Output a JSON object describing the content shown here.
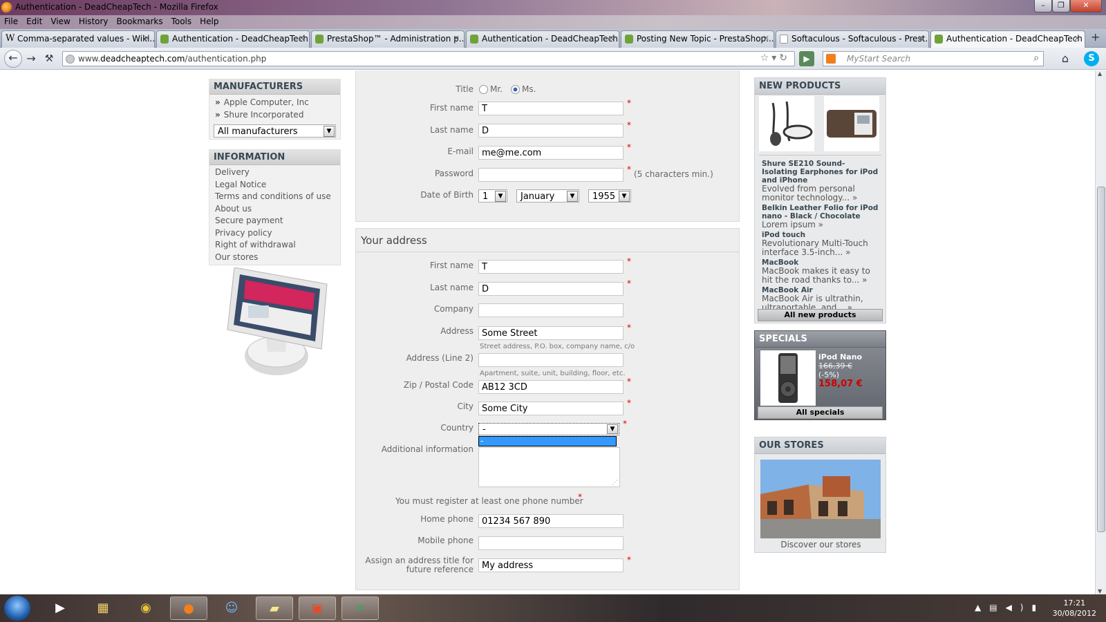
{
  "window": {
    "title": "Authentication - DeadCheapTech - Mozilla Firefox"
  },
  "menu": [
    "File",
    "Edit",
    "View",
    "History",
    "Bookmarks",
    "Tools",
    "Help"
  ],
  "tabs": [
    {
      "label": "Comma-separated values - Wiki..."
    },
    {
      "label": "Authentication - DeadCheapTech"
    },
    {
      "label": "PrestaShop™ - Administration p..."
    },
    {
      "label": "Authentication - DeadCheapTech"
    },
    {
      "label": "Posting New Topic - PrestaShop..."
    },
    {
      "label": "Softaculous - Softaculous - Prest..."
    },
    {
      "label": "Authentication - DeadCheapTech"
    }
  ],
  "url": {
    "prefix": "www.",
    "domain": "deadcheaptech.com",
    "path": "/authentication.php"
  },
  "search": {
    "placeholder": "MyStart Search"
  },
  "manufacturers": {
    "title": "Manufacturers",
    "items": [
      "Apple Computer, Inc",
      "Shure Incorporated"
    ],
    "select": "All manufacturers"
  },
  "information": {
    "title": "Information",
    "items": [
      "Delivery",
      "Legal Notice",
      "Terms and conditions of use",
      "About us",
      "Secure payment",
      "Privacy policy",
      "Right of withdrawal",
      "Our stores"
    ]
  },
  "personal": {
    "title_label": "Title",
    "mr": "Mr.",
    "ms": "Ms.",
    "first_name_label": "First name",
    "first_name": "T",
    "last_name_label": "Last name",
    "last_name": "D",
    "email_label": "E-mail",
    "email": "me@me.com",
    "password_label": "Password",
    "password_hint": "(5 characters min.)",
    "dob_label": "Date of Birth",
    "dob_day": "1",
    "dob_month": "January",
    "dob_year": "1955",
    "required": "*"
  },
  "address": {
    "heading": "Your address",
    "first_name_label": "First name",
    "first_name": "T",
    "last_name_label": "Last name",
    "last_name": "D",
    "company_label": "Company",
    "company": "",
    "address_label": "Address",
    "address": "Some Street",
    "address_hint": "Street address, P.O. box, company name, c/o",
    "address2_label": "Address (Line 2)",
    "address2": "",
    "address2_hint": "Apartment, suite, unit, building, floor, etc.",
    "zip_label": "Zip / Postal Code",
    "zip": "AB12 3CD",
    "city_label": "City",
    "city": "Some City",
    "country_label": "Country",
    "country": "-",
    "country_option": "-",
    "additional_label": "Additional information",
    "phone_note": "You must register at least one phone number",
    "home_phone_label": "Home phone",
    "home_phone": "01234 567 890",
    "mobile_phone_label": "Mobile phone",
    "mobile_phone": "",
    "alias_label_1": "Assign an address title for",
    "alias_label_2": "future reference",
    "alias": "My address"
  },
  "new_products": {
    "title": "New products",
    "items": [
      {
        "name": "Shure SE210 Sound-Isolating Earphones for iPod and iPhone",
        "desc": "Evolved from personal monitor technology... »"
      },
      {
        "name": "Belkin Leather Folio for iPod nano - Black / Chocolate",
        "desc": "Lorem ipsum »"
      },
      {
        "name": "iPod touch",
        "desc": "Revolutionary Multi-Touch interface 3.5-inch... »"
      },
      {
        "name": "MacBook",
        "desc": "MacBook makes it easy to hit the road thanks to... »"
      },
      {
        "name": "MacBook Air",
        "desc": "MacBook Air is ultrathin, ultraportable, and... »"
      }
    ],
    "button": "All new products"
  },
  "specials": {
    "title": "Specials",
    "name": "iPod Nano",
    "old_price": "166,39 €",
    "discount": "(-5%)",
    "price": "158,07 €",
    "button": "All specials",
    "price_color": "#cc0000"
  },
  "stores": {
    "title": "Our stores",
    "link": "Discover our stores"
  },
  "clock": {
    "time": "17:21",
    "date": "30/08/2012"
  },
  "colors": {
    "accent": "#374853",
    "selection": "#3399ff",
    "required": "#dd0000"
  }
}
